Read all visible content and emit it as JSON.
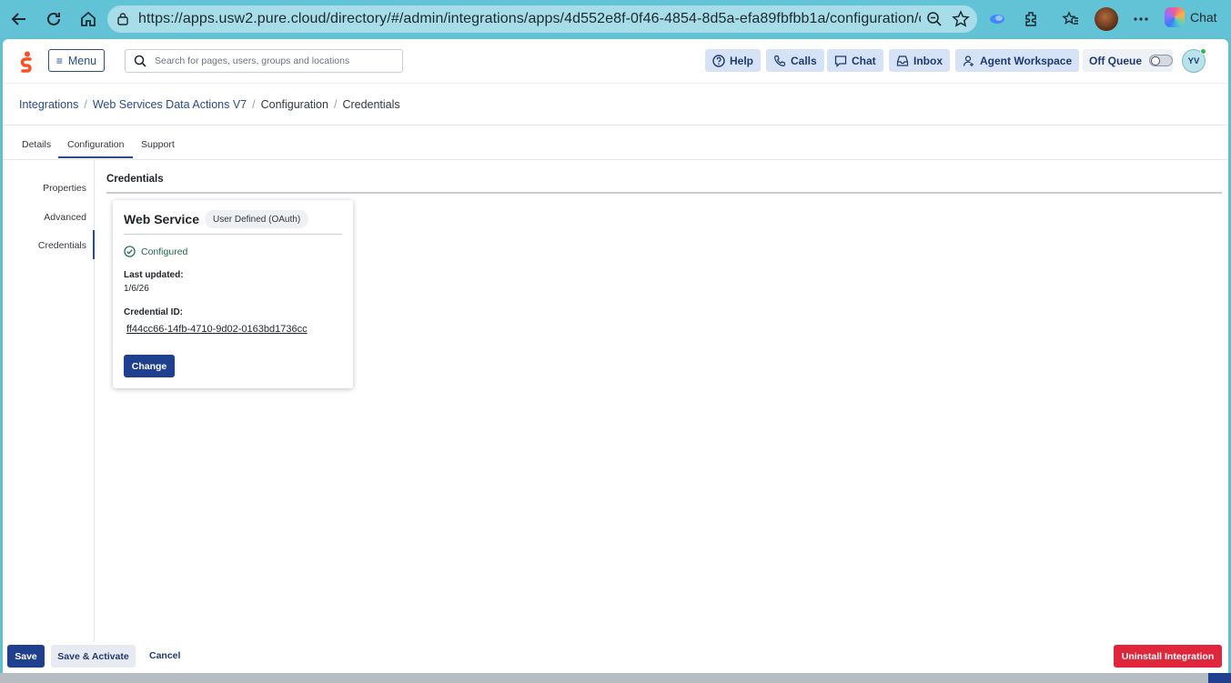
{
  "browser": {
    "url": "https://apps.usw2.pure.cloud/directory/#/admin/integrations/apps/4d552e8f-0f46-4854-8d5a-efa89fbfbb1a/configuration/crede...",
    "chat_label": "Chat"
  },
  "header": {
    "menu_label": "Menu",
    "search_placeholder": "Search for pages, users, groups and locations",
    "buttons": {
      "help": "Help",
      "calls": "Calls",
      "chat": "Chat",
      "inbox": "Inbox",
      "agent_workspace": "Agent Workspace"
    },
    "queue_label": "Off Queue",
    "user_initials": "YV"
  },
  "breadcrumb": [
    "Integrations",
    "Web Services Data Actions V7",
    "Configuration",
    "Credentials"
  ],
  "tabs": [
    "Details",
    "Configuration",
    "Support"
  ],
  "side_nav": [
    "Properties",
    "Advanced",
    "Credentials"
  ],
  "section_title": "Credentials",
  "card": {
    "title": "Web Service",
    "badge": "User Defined (OAuth)",
    "status": "Configured",
    "last_updated_label": "Last updated:",
    "last_updated_value": "1/6/26",
    "credential_id_label": "Credential ID:",
    "credential_id_value": "ff44cc66-14fb-4710-9d02-0163bd1736cc",
    "change_label": "Change"
  },
  "footer": {
    "save": "Save",
    "save_activate": "Save & Activate",
    "cancel": "Cancel",
    "uninstall": "Uninstall Integration"
  },
  "colors": {
    "primary": "#1f3f8f",
    "danger": "#e0263a",
    "success": "#1d6b4a",
    "browser_chrome": "#62c3d6"
  }
}
